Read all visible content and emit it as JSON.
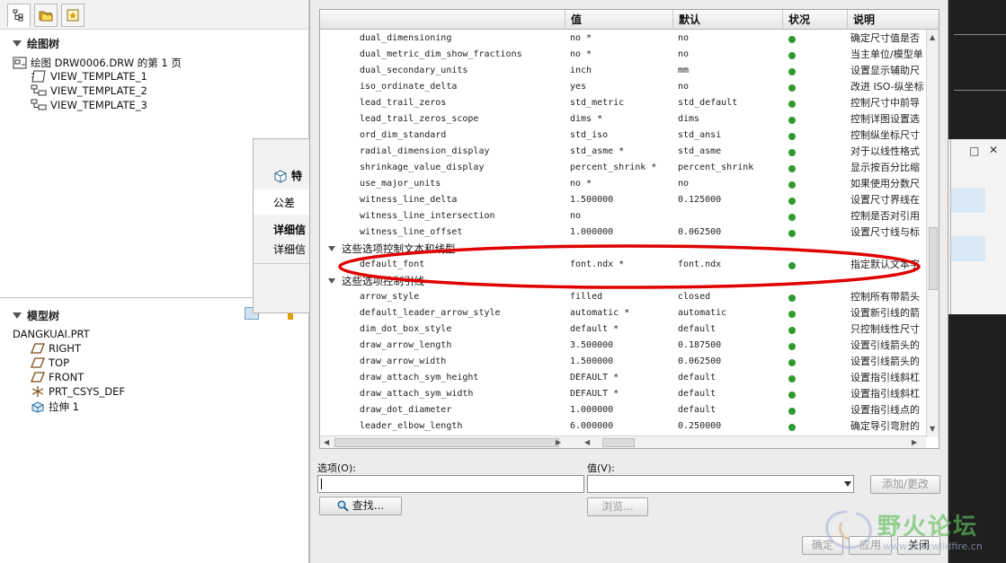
{
  "left_panel": {
    "drawing_tree": {
      "title": "绘图树",
      "root": "绘图 DRW0006.DRW 的第 1 页",
      "items": [
        "VIEW_TEMPLATE_1",
        "VIEW_TEMPLATE_2",
        "VIEW_TEMPLATE_3"
      ]
    },
    "model_tree": {
      "title": "模型树",
      "root": "DANGKUAI.PRT",
      "items": [
        "RIGHT",
        "TOP",
        "FRONT",
        "PRT_CSYS_DEF",
        "拉伸 1"
      ]
    }
  },
  "bg_dialog": {
    "title": "特",
    "tolerance": "公差",
    "details_header": "详细信",
    "details_text": "详细信"
  },
  "options_table": {
    "columns": [
      "值",
      "默认",
      "状况",
      "说明"
    ],
    "rows_top": [
      {
        "name": "dual_dimensioning",
        "value": "no *",
        "default": "no",
        "desc": "确定尺寸值是否"
      },
      {
        "name": "dual_metric_dim_show_fractions",
        "value": "no *",
        "default": "no",
        "desc": "当主单位/模型单"
      },
      {
        "name": "dual_secondary_units",
        "value": "inch",
        "default": "mm",
        "desc": "设置显示辅助尺"
      },
      {
        "name": "iso_ordinate_delta",
        "value": "yes",
        "default": "no",
        "desc": "改进 ISO-纵坐标"
      },
      {
        "name": "lead_trail_zeros",
        "value": "std_metric",
        "default": "std_default",
        "desc": "控制尺寸中前导"
      },
      {
        "name": "lead_trail_zeros_scope",
        "value": "dims *",
        "default": "dims",
        "desc": "控制详图设置选"
      },
      {
        "name": "ord_dim_standard",
        "value": "std_iso",
        "default": "std_ansi",
        "desc": "控制纵坐标尺寸"
      },
      {
        "name": "radial_dimension_display",
        "value": "std_asme *",
        "default": "std_asme",
        "desc": "对于以线性格式"
      },
      {
        "name": "shrinkage_value_display",
        "value": "percent_shrink *",
        "default": "percent_shrink",
        "desc": "显示按百分比缩"
      },
      {
        "name": "use_major_units",
        "value": "no *",
        "default": "no",
        "desc": "如果使用分数尺"
      },
      {
        "name": "witness_line_delta",
        "value": "1.500000",
        "default": "0.125000",
        "desc": "设置尺寸界线在"
      },
      {
        "name": "witness_line_intersection",
        "value": "no",
        "default": "",
        "desc": "控制是否对引用"
      },
      {
        "name": "witness_line_offset",
        "value": "1.000000",
        "default": "0.062500",
        "desc": "设置尺寸线与标"
      }
    ],
    "group1": "这些选项控制文本和线型",
    "rows_mid": [
      {
        "name": "default_font",
        "value": "font.ndx *",
        "default": "font.ndx",
        "desc": "指定默认文本字"
      }
    ],
    "group2": "这些选项控制引线",
    "rows_bottom": [
      {
        "name": "arrow_style",
        "value": "filled",
        "default": "closed",
        "desc": "控制所有带箭头"
      },
      {
        "name": "default_leader_arrow_style",
        "value": "automatic *",
        "default": "automatic",
        "desc": "设置新引线的箭"
      },
      {
        "name": "dim_dot_box_style",
        "value": "default *",
        "default": "default",
        "desc": "只控制线性尺寸"
      },
      {
        "name": "draw_arrow_length",
        "value": "3.500000",
        "default": "0.187500",
        "desc": "设置引线箭头的"
      },
      {
        "name": "draw_arrow_width",
        "value": "1.500000",
        "default": "0.062500",
        "desc": "设置引线箭头的"
      },
      {
        "name": "draw_attach_sym_height",
        "value": "DEFAULT *",
        "default": "default",
        "desc": "设置指引线斜杠"
      },
      {
        "name": "draw_attach_sym_width",
        "value": "DEFAULT *",
        "default": "default",
        "desc": "设置指引线斜杠"
      },
      {
        "name": "draw_dot_diameter",
        "value": "1.000000",
        "default": "default",
        "desc": "设置指引线点的"
      },
      {
        "name": "leader_elbow_length",
        "value": "6.000000",
        "default": "0.250000",
        "desc": "确定导引弯肘的"
      }
    ]
  },
  "controls": {
    "option_label": "选项(O):",
    "value_label": "值(V):",
    "add_change": "添加/更改",
    "find": "查找...",
    "browse": "浏览...",
    "ok": "确定",
    "apply": "应用",
    "close": "关闭"
  },
  "watermark": {
    "text": "野火论坛",
    "url": "www.proewildfire.cn"
  },
  "colors": {
    "status_ok": "#2e9a2e",
    "annotation": "#e00000"
  }
}
